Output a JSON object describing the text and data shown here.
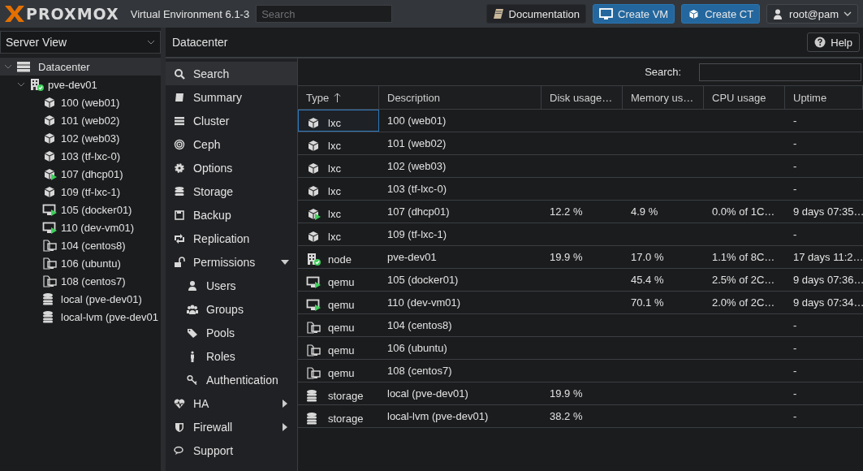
{
  "header": {
    "logo": "PROXMOX",
    "version": "Virtual Environment 6.1-3",
    "search": {
      "placeholder": "Search"
    },
    "buttons": [
      {
        "label": "Documentation",
        "kind": "docs"
      },
      {
        "label": "Create VM",
        "kind": "vm"
      },
      {
        "label": "Create CT",
        "kind": "ct"
      }
    ],
    "user": "root@pam"
  },
  "sidebar": {
    "view": "Server View",
    "tree": [
      {
        "label": "Datacenter",
        "kind": "datacenter",
        "selected": true,
        "expanded": true,
        "children": [
          {
            "label": "pve-dev01",
            "kind": "node-online",
            "selected": false,
            "expanded": true,
            "children": [
              {
                "label": "100 (web01)",
                "kind": "ct",
                "selected": false
              },
              {
                "label": "101 (web02)",
                "kind": "ct",
                "selected": false
              },
              {
                "label": "102 (web03)",
                "kind": "ct",
                "selected": false
              },
              {
                "label": "103 (tf-lxc-0)",
                "kind": "ct",
                "selected": false
              },
              {
                "label": "107 (dhcp01)",
                "kind": "ct-running",
                "selected": false
              },
              {
                "label": "109 (tf-lxc-1)",
                "kind": "ct",
                "selected": false
              },
              {
                "label": "105 (docker01)",
                "kind": "vm-running",
                "selected": false
              },
              {
                "label": "110 (dev-vm01)",
                "kind": "vm-running",
                "selected": false
              },
              {
                "label": "104 (centos8)",
                "kind": "vm-template",
                "selected": false
              },
              {
                "label": "106 (ubuntu)",
                "kind": "vm-template",
                "selected": false
              },
              {
                "label": "108 (centos7)",
                "kind": "vm-template",
                "selected": false
              },
              {
                "label": "local (pve-dev01)",
                "kind": "storage",
                "selected": false
              },
              {
                "label": "local-lvm (pve-dev01",
                "kind": "storage",
                "selected": false
              }
            ]
          }
        ]
      }
    ]
  },
  "panel": {
    "title": "Datacenter",
    "help": "Help",
    "nav": [
      {
        "label": "Search",
        "kind": "search",
        "selected": true
      },
      {
        "label": "Summary",
        "kind": "summary",
        "selected": false
      },
      {
        "label": "Cluster",
        "kind": "cluster",
        "selected": false
      },
      {
        "label": "Ceph",
        "kind": "ceph",
        "selected": false
      },
      {
        "label": "Options",
        "kind": "options",
        "selected": false
      },
      {
        "label": "Storage",
        "kind": "storage",
        "selected": false
      },
      {
        "label": "Backup",
        "kind": "backup",
        "selected": false
      },
      {
        "label": "Replication",
        "kind": "replication",
        "selected": false
      },
      {
        "label": "Permissions",
        "kind": "permissions",
        "selected": false,
        "expanded": true,
        "children": [
          {
            "label": "Users",
            "kind": "users",
            "selected": false
          },
          {
            "label": "Groups",
            "kind": "groups",
            "selected": false
          },
          {
            "label": "Pools",
            "kind": "pools",
            "selected": false
          },
          {
            "label": "Roles",
            "kind": "roles",
            "selected": false
          },
          {
            "label": "Authentication",
            "kind": "authentication",
            "selected": false
          }
        ]
      },
      {
        "label": "HA",
        "kind": "ha",
        "selected": false,
        "expanded": false
      },
      {
        "label": "Firewall",
        "kind": "firewall",
        "selected": false,
        "expanded": false
      },
      {
        "label": "Support",
        "kind": "support",
        "selected": false
      }
    ],
    "search_label": "Search:",
    "table": {
      "columns": [
        {
          "label": "Type",
          "sorted": true
        },
        {
          "label": "Description",
          "sorted": false
        },
        {
          "label": "Disk usage…",
          "sorted": false
        },
        {
          "label": "Memory us…",
          "sorted": false
        },
        {
          "label": "CPU usage",
          "sorted": false
        },
        {
          "label": "Uptime",
          "sorted": false
        }
      ],
      "rows": [
        {
          "kind": "ct",
          "selected": true,
          "cells": [
            "lxc",
            "100 (web01)",
            "",
            "",
            "",
            "-"
          ]
        },
        {
          "kind": "ct",
          "selected": false,
          "cells": [
            "lxc",
            "101 (web02)",
            "",
            "",
            "",
            "-"
          ]
        },
        {
          "kind": "ct",
          "selected": false,
          "cells": [
            "lxc",
            "102 (web03)",
            "",
            "",
            "",
            "-"
          ]
        },
        {
          "kind": "ct",
          "selected": false,
          "cells": [
            "lxc",
            "103 (tf-lxc-0)",
            "",
            "",
            "",
            "-"
          ]
        },
        {
          "kind": "ct-running",
          "selected": false,
          "cells": [
            "lxc",
            "107 (dhcp01)",
            "12.2 %",
            "4.9 %",
            "0.0% of 1C…",
            "9 days 07:35…"
          ]
        },
        {
          "kind": "ct",
          "selected": false,
          "cells": [
            "lxc",
            "109 (tf-lxc-1)",
            "",
            "",
            "",
            "-"
          ]
        },
        {
          "kind": "node-online",
          "selected": false,
          "cells": [
            "node",
            "pve-dev01",
            "19.9 %",
            "17.0 %",
            "1.1% of 8C…",
            "17 days 11:2…"
          ]
        },
        {
          "kind": "vm-running",
          "selected": false,
          "cells": [
            "qemu",
            "105 (docker01)",
            "",
            "45.4 %",
            "2.5% of 2C…",
            "9 days 07:36…"
          ]
        },
        {
          "kind": "vm-running",
          "selected": false,
          "cells": [
            "qemu",
            "110 (dev-vm01)",
            "",
            "70.1 %",
            "2.0% of 2C…",
            "9 days 07:34…"
          ]
        },
        {
          "kind": "vm-template",
          "selected": false,
          "cells": [
            "qemu",
            "104 (centos8)",
            "",
            "",
            "",
            "-"
          ]
        },
        {
          "kind": "vm-template",
          "selected": false,
          "cells": [
            "qemu",
            "106 (ubuntu)",
            "",
            "",
            "",
            "-"
          ]
        },
        {
          "kind": "vm-template",
          "selected": false,
          "cells": [
            "qemu",
            "108 (centos7)",
            "",
            "",
            "",
            "-"
          ]
        },
        {
          "kind": "storage",
          "selected": false,
          "cells": [
            "storage",
            "local (pve-dev01)",
            "19.9 %",
            "",
            "",
            "-"
          ]
        },
        {
          "kind": "storage",
          "selected": false,
          "cells": [
            "storage",
            "local-lvm (pve-dev01)",
            "38.2 %",
            "",
            "",
            "-"
          ]
        }
      ]
    }
  }
}
